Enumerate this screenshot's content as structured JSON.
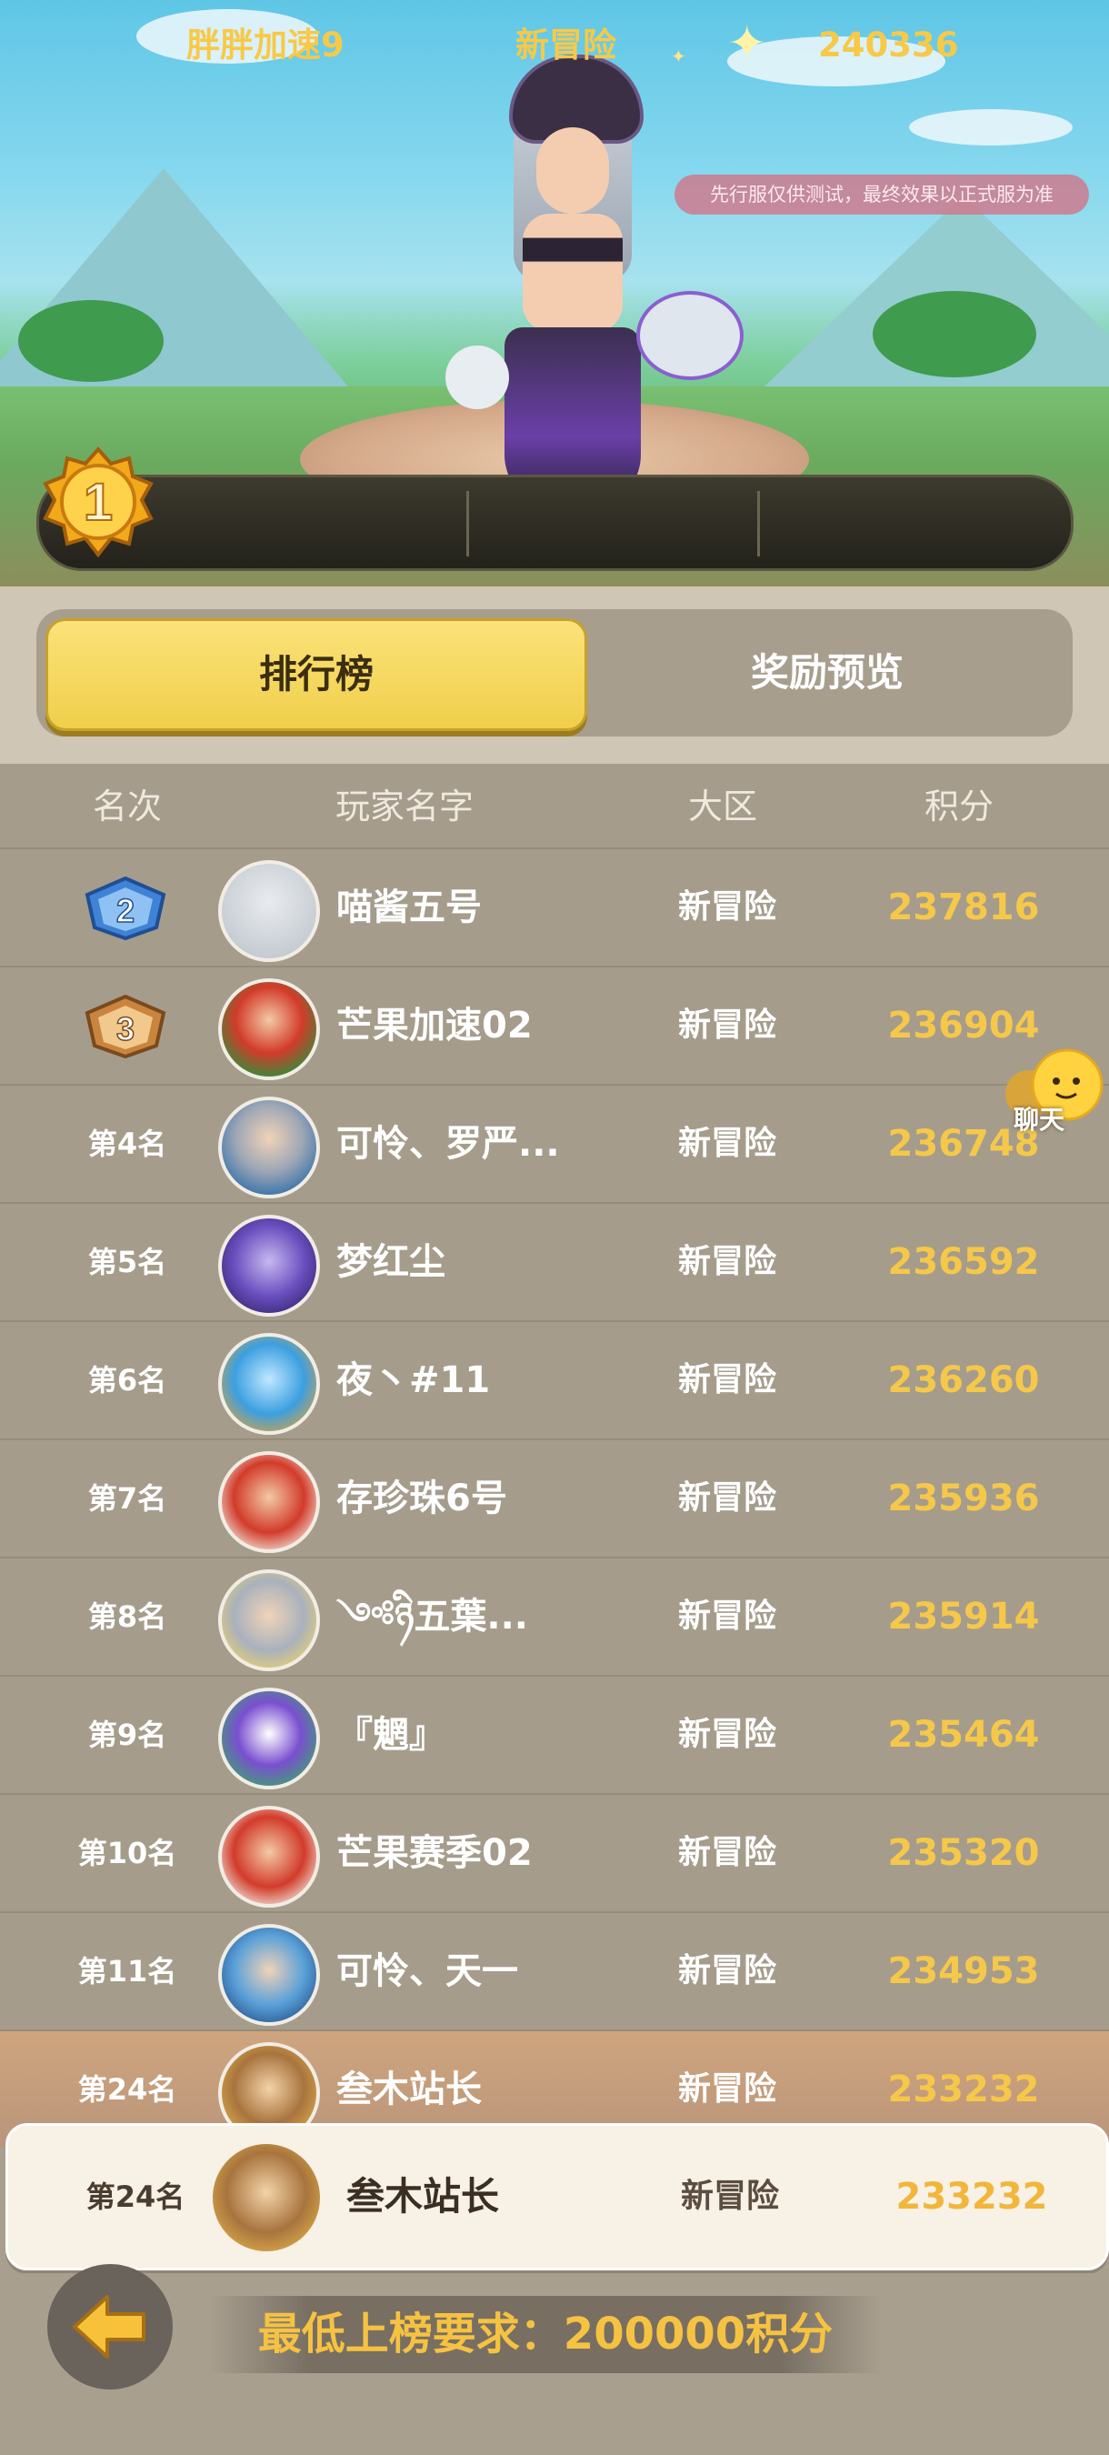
{
  "notice": "先行服仅供测试，最终效果以正式服为准",
  "champion": {
    "rank": "1",
    "name": "胖胖加速9",
    "zone": "新冒险",
    "score": "240336"
  },
  "tabs": {
    "active": "排行榜",
    "inactive": "奖励预览"
  },
  "headers": {
    "rank": "名次",
    "player": "玩家名字",
    "zone": "大区",
    "score": "积分"
  },
  "rows": [
    {
      "rank": "2",
      "name": "喵酱五号",
      "zone": "新冒险",
      "score": "237816"
    },
    {
      "rank": "3",
      "name": "芒果加速02",
      "zone": "新冒险",
      "score": "236904"
    },
    {
      "rank": "第4名",
      "name": "可怜、罗严...",
      "zone": "新冒险",
      "score": "236748"
    },
    {
      "rank": "第5名",
      "name": "梦红尘",
      "zone": "新冒险",
      "score": "236592"
    },
    {
      "rank": "第6名",
      "name": "夜丶#11",
      "zone": "新冒险",
      "score": "236260"
    },
    {
      "rank": "第7名",
      "name": "存珍珠6号",
      "zone": "新冒险",
      "score": "235936"
    },
    {
      "rank": "第8名",
      "name": "༺ཉི五葉...",
      "zone": "新冒险",
      "score": "235914"
    },
    {
      "rank": "第9名",
      "name": "『魍』",
      "zone": "新冒险",
      "score": "235464"
    },
    {
      "rank": "第10名",
      "name": "芒果赛季02",
      "zone": "新冒险",
      "score": "235320"
    },
    {
      "rank": "第11名",
      "name": "可怜、天一",
      "zone": "新冒险",
      "score": "234953"
    },
    {
      "rank": "第24名",
      "name": "叁木站长",
      "zone": "新冒险",
      "score": "233232"
    }
  ],
  "own": {
    "rank": "第24名",
    "name": "叁木站长",
    "zone": "新冒险",
    "score": "233232"
  },
  "chat_label": "聊天",
  "min_requirement": "最低上榜要求：200000积分",
  "icons": {
    "back": "back-arrow-icon",
    "chat": "chat-bubble-icon",
    "score": "sparkle-star-icon"
  },
  "colors": {
    "gold": "#f6c84a",
    "tab_active": "#f0cf4a",
    "panel": "#a59c8c"
  }
}
